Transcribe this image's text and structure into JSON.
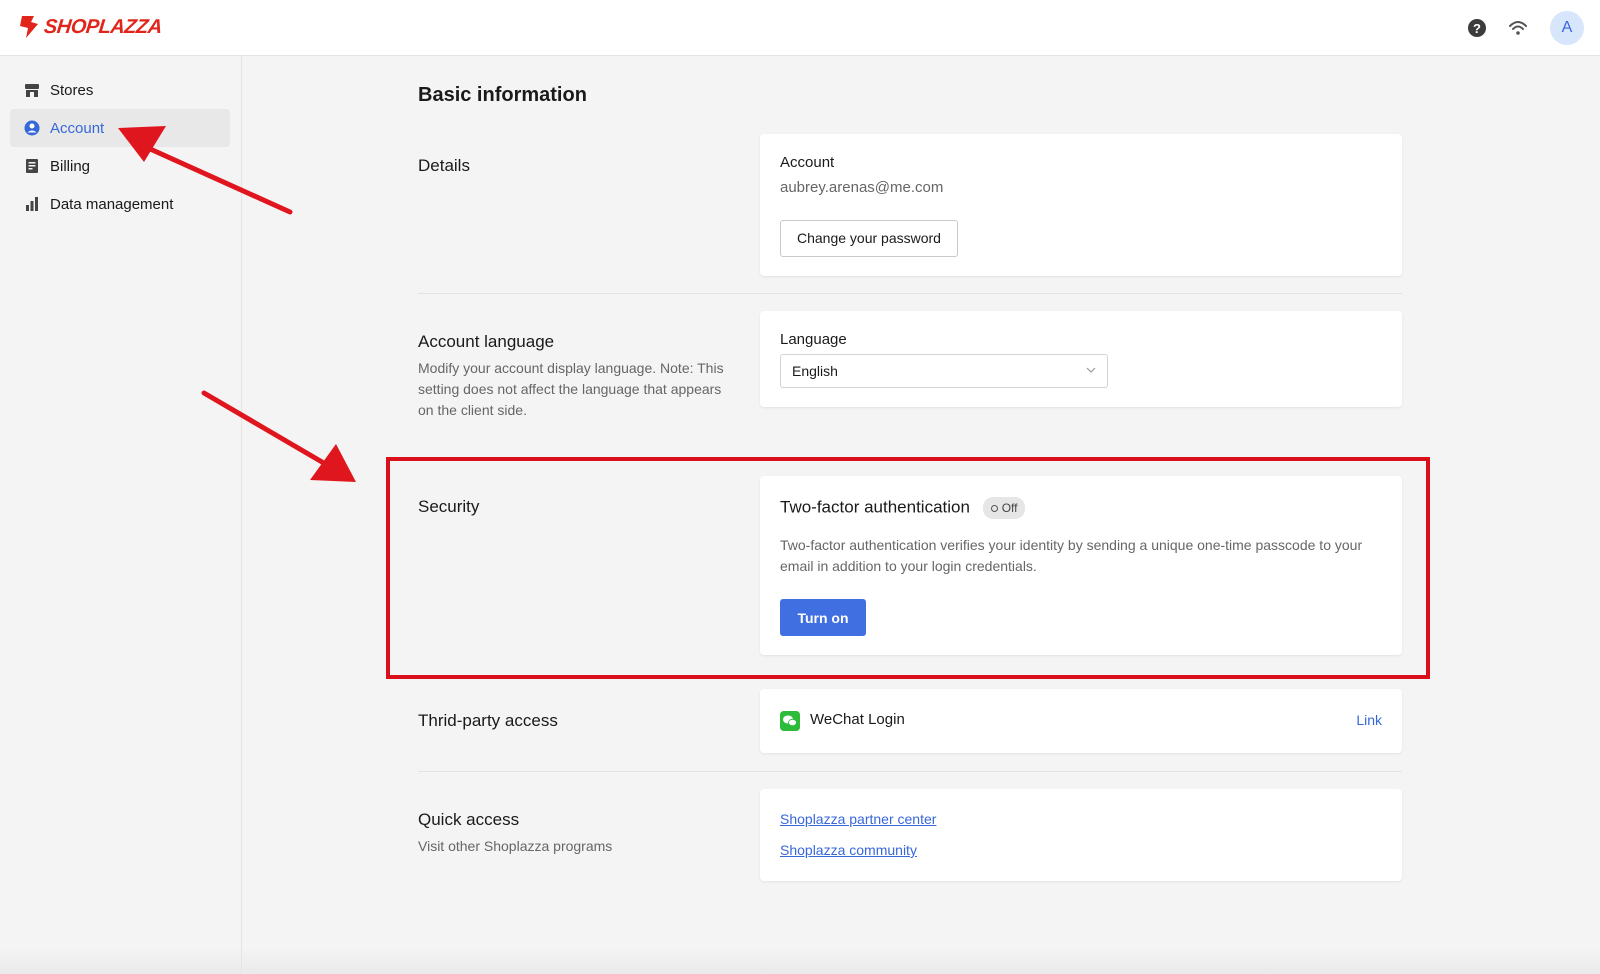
{
  "brand": {
    "name": "SHOPLAZZA",
    "color": "#e1251b"
  },
  "topbar": {
    "help_icon": "question-circle-icon",
    "wifi_icon": "wifi-icon",
    "avatar_initial": "A"
  },
  "sidebar": {
    "items": [
      {
        "label": "Stores",
        "icon": "store-icon",
        "active": false
      },
      {
        "label": "Account",
        "icon": "user-circle-icon",
        "active": true
      },
      {
        "label": "Billing",
        "icon": "document-icon",
        "active": false
      },
      {
        "label": "Data management",
        "icon": "bar-chart-icon",
        "active": false
      }
    ]
  },
  "main": {
    "title": "Basic information",
    "details": {
      "label": "Details",
      "account_label": "Account",
      "account_email": "aubrey.arenas@me.com",
      "change_password_label": "Change your password"
    },
    "language": {
      "label": "Account language",
      "description": "Modify your account display language. Note: This setting does not affect the language that appears on the client side.",
      "field_label": "Language",
      "selected": "English"
    },
    "security": {
      "label": "Security",
      "title": "Two-factor authentication",
      "status": "Off",
      "description": "Two-factor authentication verifies your identity by sending a unique one-time passcode to your email in addition to your login credentials.",
      "button_label": "Turn on"
    },
    "third_party": {
      "label": "Thrid-party access",
      "service": "WeChat Login",
      "action_label": "Link"
    },
    "quick_access": {
      "label": "Quick access",
      "description": "Visit other Shoplazza programs",
      "links": [
        "Shoplazza partner center",
        "Shoplazza community"
      ]
    }
  },
  "colors": {
    "accent": "#3f6fe0",
    "link": "#3767d9",
    "annotation": "#d9101c"
  }
}
